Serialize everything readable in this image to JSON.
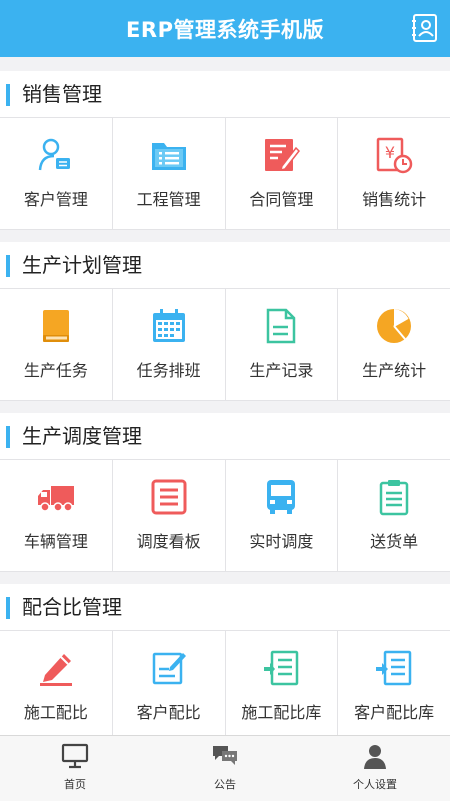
{
  "header": {
    "title": "ERP管理系统手机版"
  },
  "colors": {
    "primary": "#3bb2f0",
    "background": "#f2f2f4"
  },
  "sections": [
    {
      "title": "销售管理",
      "items": [
        {
          "label": "客户管理",
          "icon": "customer-icon"
        },
        {
          "label": "工程管理",
          "icon": "project-folder-icon"
        },
        {
          "label": "合同管理",
          "icon": "contract-icon"
        },
        {
          "label": "销售统计",
          "icon": "sales-stats-icon"
        }
      ]
    },
    {
      "title": "生产计划管理",
      "items": [
        {
          "label": "生产任务",
          "icon": "book-icon"
        },
        {
          "label": "任务排班",
          "icon": "calendar-icon"
        },
        {
          "label": "生产记录",
          "icon": "document-icon"
        },
        {
          "label": "生产统计",
          "icon": "pie-chart-icon"
        }
      ]
    },
    {
      "title": "生产调度管理",
      "items": [
        {
          "label": "车辆管理",
          "icon": "truck-icon"
        },
        {
          "label": "调度看板",
          "icon": "board-icon"
        },
        {
          "label": "实时调度",
          "icon": "bus-icon"
        },
        {
          "label": "送货单",
          "icon": "clipboard-icon"
        }
      ]
    },
    {
      "title": "配合比管理",
      "items": [
        {
          "label": "施工配比",
          "icon": "pencil-icon"
        },
        {
          "label": "客户配比",
          "icon": "edit-icon"
        },
        {
          "label": "施工配比库",
          "icon": "import-list-icon"
        },
        {
          "label": "客户配比库",
          "icon": "export-list-icon"
        }
      ]
    }
  ],
  "tabbar": [
    {
      "label": "首页",
      "icon": "monitor-icon"
    },
    {
      "label": "公告",
      "icon": "chat-icon"
    },
    {
      "label": "个人设置",
      "icon": "user-icon"
    }
  ]
}
